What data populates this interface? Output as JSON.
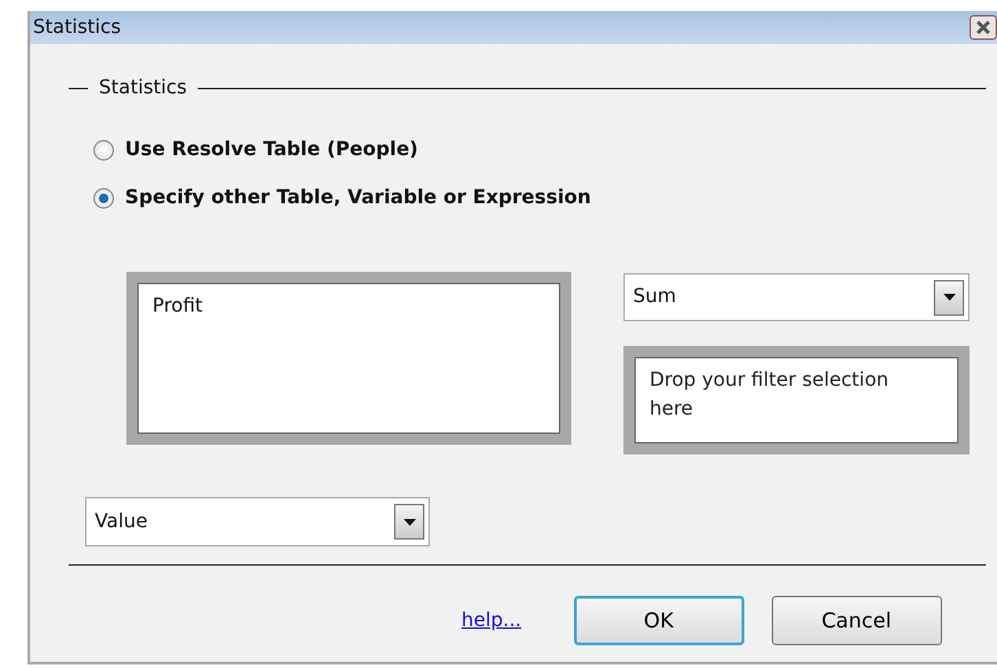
{
  "window": {
    "title": "Statistics"
  },
  "group": {
    "legend": "Statistics"
  },
  "options": [
    {
      "label": "Use Resolve Table (People)",
      "selected": false
    },
    {
      "label": "Specify other Table, Variable or Expression",
      "selected": true
    }
  ],
  "expression_box": {
    "value": "Profit"
  },
  "aggregate_dropdown": {
    "value": "Sum"
  },
  "filter_box": {
    "placeholder": "Drop your filter selection here"
  },
  "display_dropdown": {
    "value": "Value"
  },
  "help_link": "help...",
  "buttons": [
    {
      "label": "OK",
      "default": true
    },
    {
      "label": "Cancel",
      "default": false
    }
  ]
}
